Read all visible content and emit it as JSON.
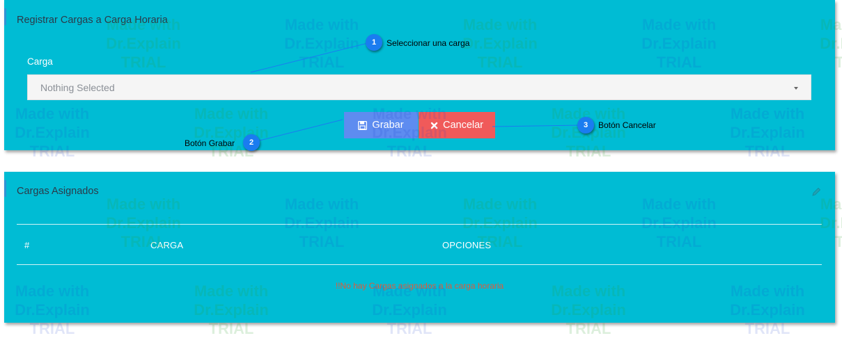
{
  "form_panel": {
    "title": "Registrar Cargas a Carga Horaria",
    "field_label": "Carga",
    "select": {
      "value": "Nothing Selected",
      "icon": "caret-down-icon"
    },
    "save_button": {
      "label": "Grabar",
      "icon": "floppy-disk-icon",
      "color": "#5e8cf0"
    },
    "cancel_button": {
      "label": "Cancelar",
      "icon": "close-icon",
      "color": "#f05a5a"
    }
  },
  "list_panel": {
    "title": "Cargas Asignados",
    "edit_icon": "pencil-icon",
    "columns": [
      "#",
      "CARGA",
      "OPCIONES"
    ],
    "rows": [],
    "empty_message": "!!No hay Cargas asignados a la carga horaria"
  },
  "callouts": [
    {
      "number": "1",
      "text": "Seleccionar una carga"
    },
    {
      "number": "2",
      "text": "Botón Grabar"
    },
    {
      "number": "3",
      "text": "Botón Cancelar"
    }
  ],
  "watermark": {
    "line1": "Made with",
    "line2": "Dr.Explain",
    "line3": "TRIAL"
  },
  "colors": {
    "panel": "#00bcd4",
    "callout": "#1a7cf0",
    "empty_message": "#e05a3a"
  }
}
